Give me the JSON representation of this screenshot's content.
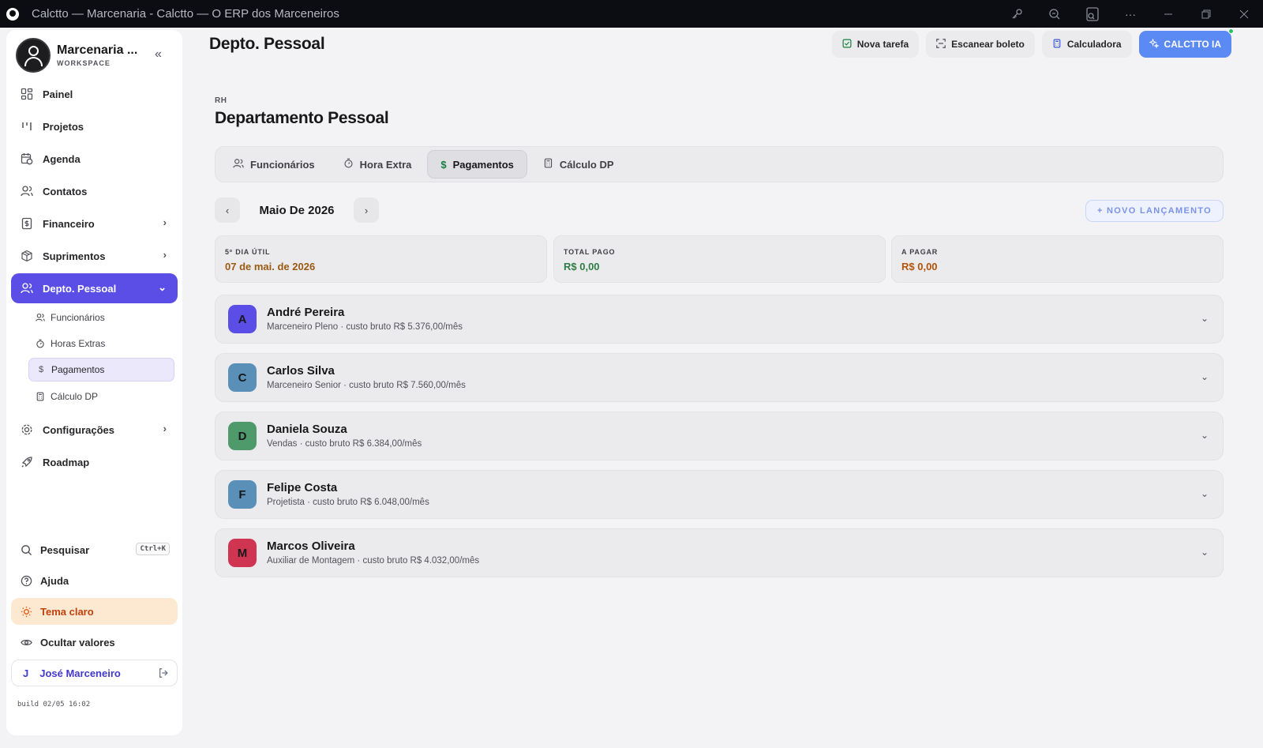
{
  "window": {
    "title": "Calctto — Marcenaria - Calctto — O ERP dos Marceneiros"
  },
  "sidebar": {
    "brand_name": "Marcenaria ...",
    "brand_sub": "WORKSPACE",
    "nav": [
      {
        "label": "Painel"
      },
      {
        "label": "Projetos"
      },
      {
        "label": "Agenda"
      },
      {
        "label": "Contatos"
      },
      {
        "label": "Financeiro"
      },
      {
        "label": "Suprimentos"
      },
      {
        "label": "Depto. Pessoal"
      },
      {
        "label": "Configurações"
      },
      {
        "label": "Roadmap"
      }
    ],
    "sub_items": [
      {
        "label": "Funcionários"
      },
      {
        "label": "Horas Extras"
      },
      {
        "label": "Pagamentos"
      },
      {
        "label": "Cálculo DP"
      }
    ],
    "search_label": "Pesquisar",
    "search_shortcut": "Ctrl+K",
    "help_label": "Ajuda",
    "theme_label": "Tema claro",
    "hide_values_label": "Ocultar valores",
    "user_initial": "J",
    "user_name": "José Marceneiro",
    "build": "build 02/05 16:02"
  },
  "header": {
    "page_title": "Depto. Pessoal",
    "actions": {
      "new_task": "Nova tarefa",
      "scan_boleto": "Escanear boleto",
      "calculator": "Calculadora",
      "ai": "CALCTTO IA"
    }
  },
  "main": {
    "kicker": "RH",
    "title": "Departamento Pessoal",
    "tabs": [
      {
        "label": "Funcionários"
      },
      {
        "label": "Hora Extra"
      },
      {
        "label": "Pagamentos"
      },
      {
        "label": "Cálculo DP"
      }
    ],
    "month": "Maio De 2026",
    "new_entry": "+ NOVO LANÇAMENTO",
    "stats": [
      {
        "label": "5º DIA ÚTIL",
        "value": "07 de mai. de 2026",
        "color": "#9a5a12"
      },
      {
        "label": "TOTAL PAGO",
        "value": "R$ 0,00",
        "color": "#2f7d45"
      },
      {
        "label": "A PAGAR",
        "value": "R$ 0,00",
        "color": "#b45309"
      }
    ],
    "employees": [
      {
        "initial": "A",
        "name": "André Pereira",
        "meta": "Marceneiro Pleno · custo bruto R$ 5.376,00/mês",
        "color": "#5b4ee6"
      },
      {
        "initial": "C",
        "name": "Carlos Silva",
        "meta": "Marceneiro Senior · custo bruto R$ 7.560,00/mês",
        "color": "#5a90b8"
      },
      {
        "initial": "D",
        "name": "Daniela Souza",
        "meta": "Vendas · custo bruto R$ 6.384,00/mês",
        "color": "#4f9a6b"
      },
      {
        "initial": "F",
        "name": "Felipe Costa",
        "meta": "Projetista · custo bruto R$ 6.048,00/mês",
        "color": "#5a90b8"
      },
      {
        "initial": "M",
        "name": "Marcos Oliveira",
        "meta": "Auxiliar de Montagem · custo bruto R$ 4.032,00/mês",
        "color": "#cf3550"
      }
    ]
  }
}
